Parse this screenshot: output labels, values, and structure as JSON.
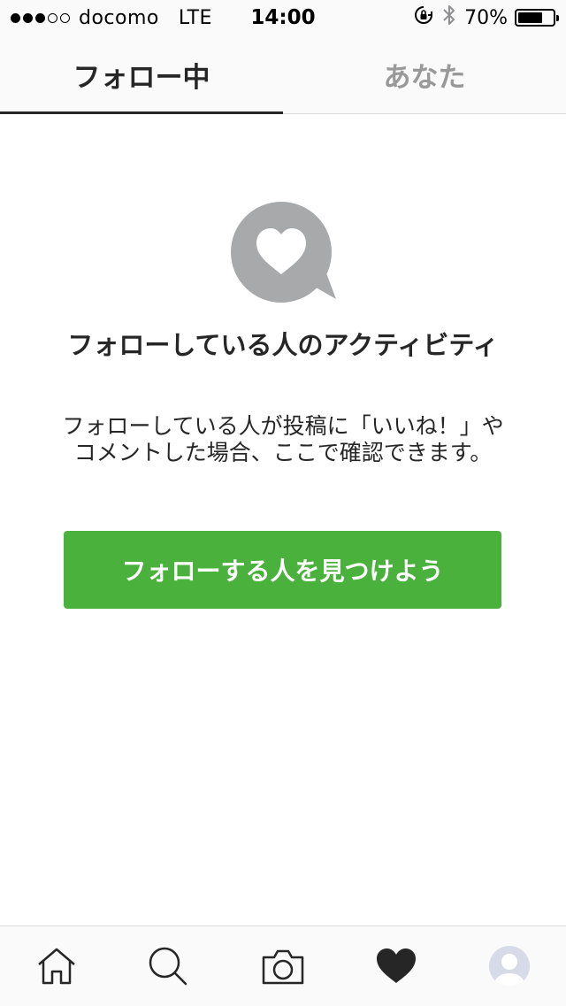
{
  "status_bar": {
    "carrier": "docomo",
    "network": "LTE",
    "time": "14:00",
    "battery": "70%",
    "battery_level": 0.7,
    "signal_bars_filled": 3,
    "signal_bars_total": 5
  },
  "tabs": [
    {
      "label": "フォロー中",
      "active": true
    },
    {
      "label": "あなた",
      "active": false
    }
  ],
  "empty_state": {
    "icon": "heart-speech-bubble-icon",
    "title": "フォローしている人のアクティビティ",
    "description": "フォローしている人が投稿に「いいね！」やコメントした場合、ここで確認できます。",
    "button_label": "フォローする人を見つけよう"
  },
  "bottom_nav": {
    "items": [
      "home-icon",
      "search-icon",
      "camera-icon",
      "heart-icon",
      "profile-icon"
    ],
    "active": "heart-icon"
  },
  "colors": {
    "accent_green": "#4bb13d",
    "icon_gray": "#a8a9ab",
    "text_dark": "#262626",
    "text_inactive": "#999999"
  }
}
